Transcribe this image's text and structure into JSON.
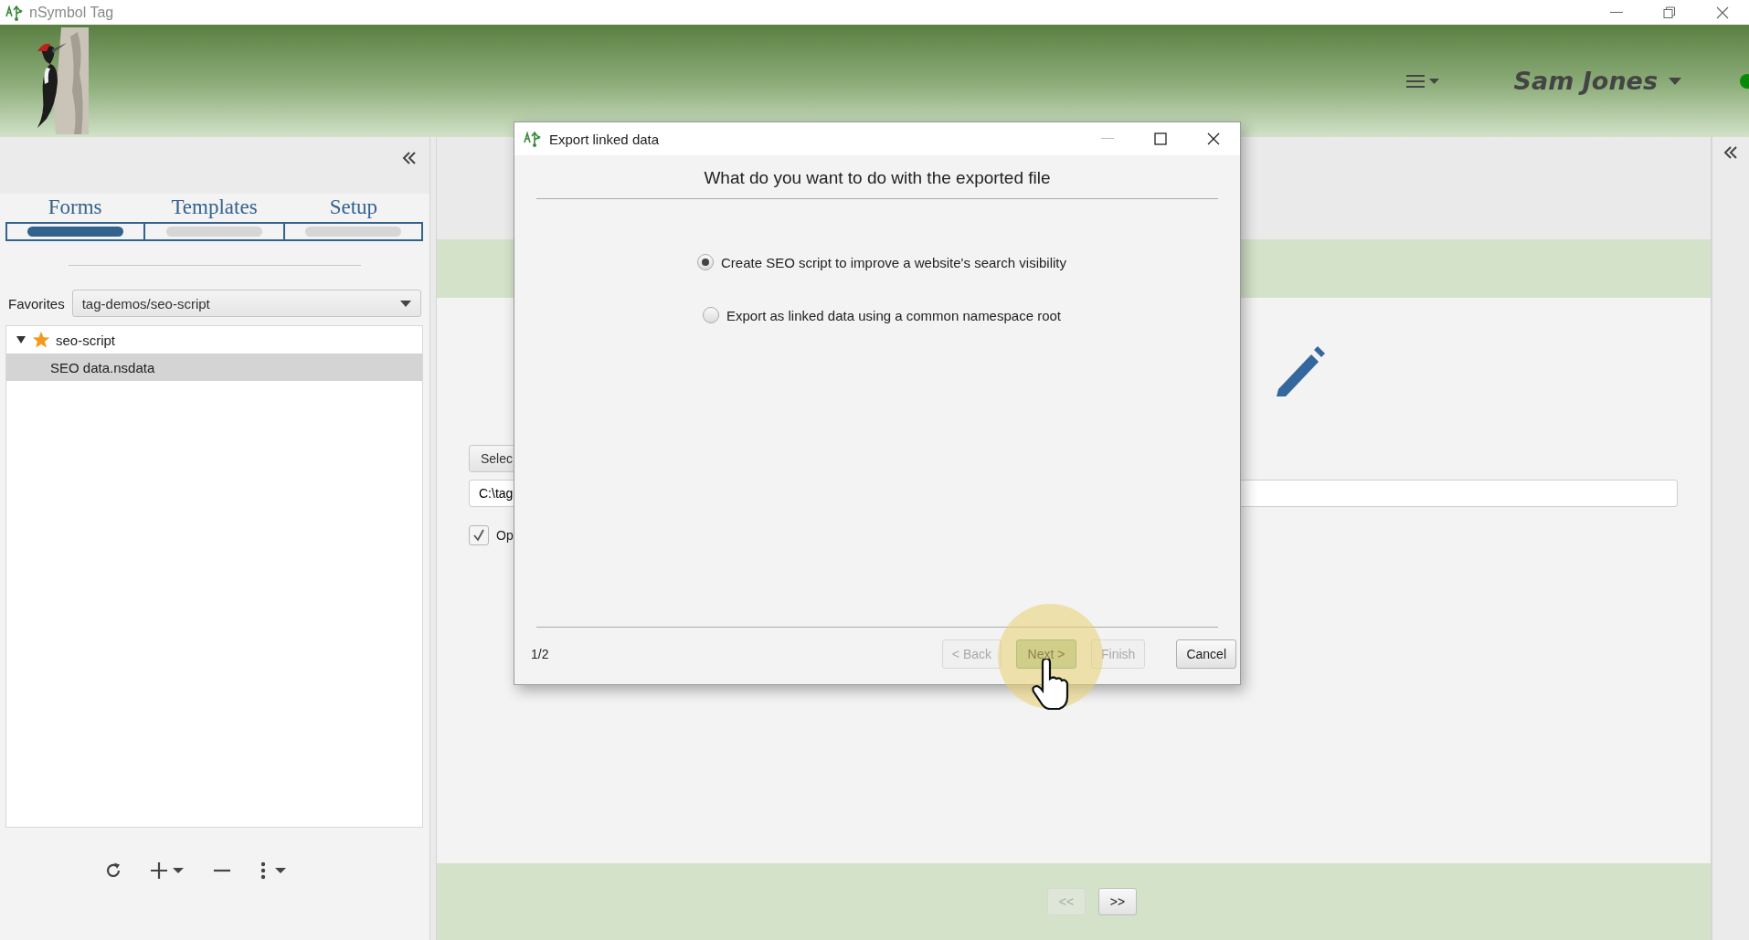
{
  "app_window": {
    "title": "nSymbol Tag"
  },
  "header": {
    "user": "Sam Jones"
  },
  "left_panel": {
    "tabs": [
      {
        "label": "Forms",
        "selected": true
      },
      {
        "label": "Templates",
        "selected": false
      },
      {
        "label": "Setup",
        "selected": false
      }
    ],
    "favorites": {
      "label": "Favorites",
      "value": "tag-demos/seo-script"
    },
    "tree": [
      {
        "label": "seo-script",
        "starred": true,
        "expanded": true,
        "selected": false,
        "children": [
          {
            "label": "SEO data.nsdata",
            "starred": false,
            "selected": true
          }
        ]
      }
    ]
  },
  "form": {
    "select_button": "Selec",
    "path_field": "C:\\tag",
    "option": {
      "label": "Op",
      "checked": true
    }
  },
  "pager": [
    {
      "label": "<<",
      "disabled": true
    },
    {
      "label": ">>",
      "disabled": false
    }
  ],
  "dialog": {
    "title": "Export linked data",
    "heading": "What do you want to do with the exported file",
    "options": [
      {
        "label": "Create SEO script to improve a website's search visibility",
        "selected": true
      },
      {
        "label": "Export as linked data using a common namespace root",
        "selected": false
      }
    ],
    "page": "1/2",
    "buttons": [
      {
        "label": "< Back",
        "disabled": true,
        "default": false
      },
      {
        "label": "Next >",
        "disabled": false,
        "default": true
      },
      {
        "label": "Finish",
        "disabled": true,
        "default": false
      },
      {
        "label": "Cancel",
        "disabled": false,
        "default": false
      }
    ]
  }
}
